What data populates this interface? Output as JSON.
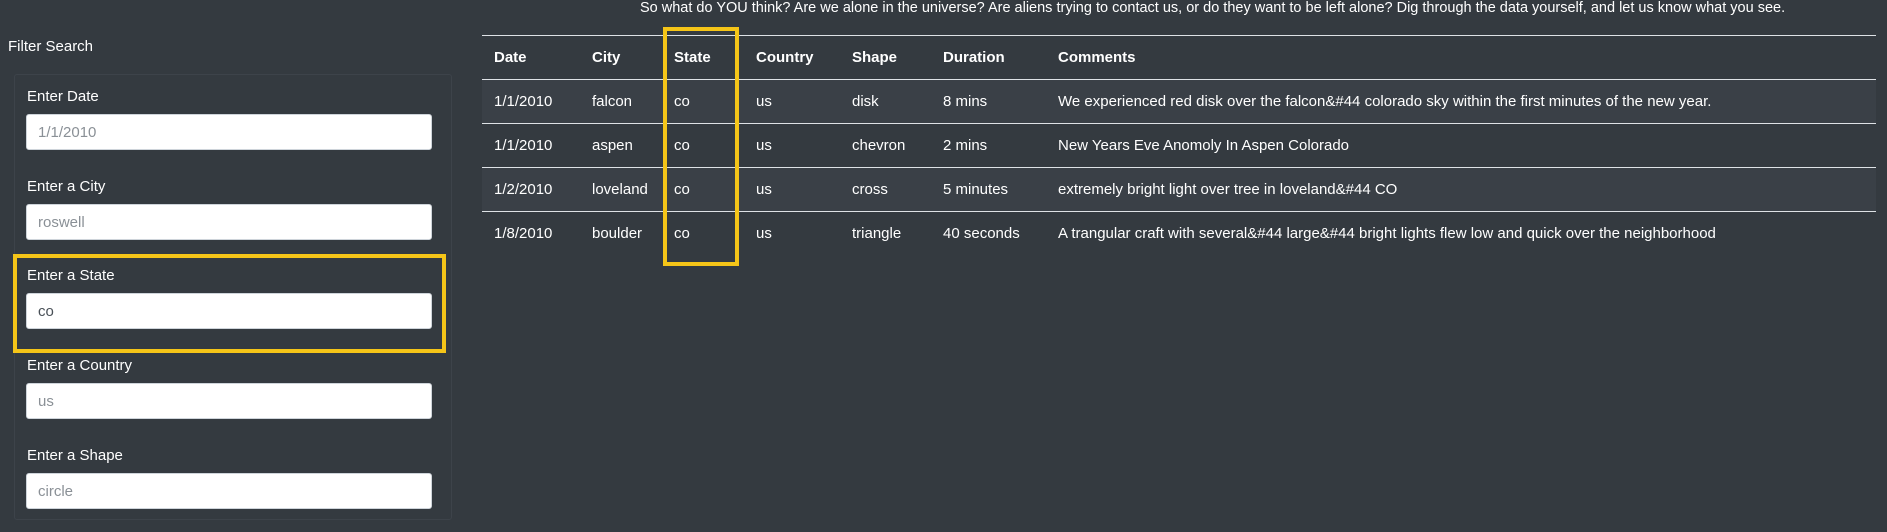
{
  "intro_text": "So what do YOU think? Are we alone in the universe? Are aliens trying to contact us, or do they want to be left alone? Dig through the data yourself, and let us know what you see.",
  "filter": {
    "title": "Filter Search",
    "fields": [
      {
        "label": "Enter Date",
        "value": "",
        "placeholder": "1/1/2010"
      },
      {
        "label": "Enter a City",
        "value": "",
        "placeholder": "roswell"
      },
      {
        "label": "Enter a State",
        "value": "co",
        "placeholder": ""
      },
      {
        "label": "Enter a Country",
        "value": "",
        "placeholder": "us"
      },
      {
        "label": "Enter a Shape",
        "value": "",
        "placeholder": "circle"
      }
    ]
  },
  "table": {
    "headers": [
      "Date",
      "City",
      "State",
      "Country",
      "Shape",
      "Duration",
      "Comments"
    ],
    "rows": [
      [
        "1/1/2010",
        "falcon",
        "co",
        "us",
        "disk",
        "8 mins",
        "We experienced red disk over the falcon&#44 colorado sky within the first minutes of the new year."
      ],
      [
        "1/1/2010",
        "aspen",
        "co",
        "us",
        "chevron",
        "2 mins",
        "New Years Eve Anomoly In Aspen Colorado"
      ],
      [
        "1/2/2010",
        "loveland",
        "co",
        "us",
        "cross",
        "5 minutes",
        "extremely bright light over tree in loveland&#44 CO"
      ],
      [
        "1/8/2010",
        "boulder",
        "co",
        "us",
        "triangle",
        "40 seconds",
        "A trangular craft with several&#44 large&#44 bright lights flew low and quick over the neighborhood"
      ]
    ]
  },
  "colors": {
    "background": "#343a40",
    "highlight": "#f5c518"
  }
}
